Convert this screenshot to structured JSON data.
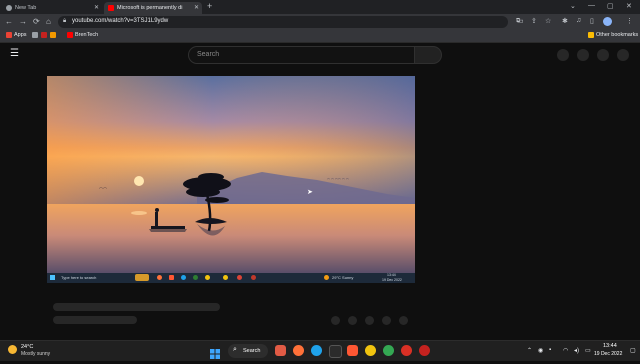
{
  "browser": {
    "tabs": [
      {
        "label": "New Tab"
      },
      {
        "label": "Microsoft is permanently di"
      }
    ],
    "new_tab": "+",
    "url": "youtube.com/watch?v=3TSJ1L9ydw",
    "bookmarks": {
      "apps": "Apps",
      "item1": "BrenTech",
      "other": "Other bookmarks"
    }
  },
  "youtube": {
    "search_placeholder": "Search"
  },
  "video": {
    "inner_taskbar": {
      "search_placeholder": "Type here to search",
      "weather": "29°C  Sunny",
      "time": "13:44",
      "date": "19 Dec 2022"
    }
  },
  "taskbar": {
    "weather_temp": "24°C",
    "weather_desc": "Mostly sunny",
    "search_label": "Search",
    "time": "13:44",
    "date": "19 Dec 2022"
  },
  "colors": {
    "yt_background": "#0f0f0f",
    "chrome_toolbar": "#35363a",
    "chrome_tabstrip": "#202124",
    "taskbar": "#202020",
    "youtube_red": "#ff0000"
  }
}
